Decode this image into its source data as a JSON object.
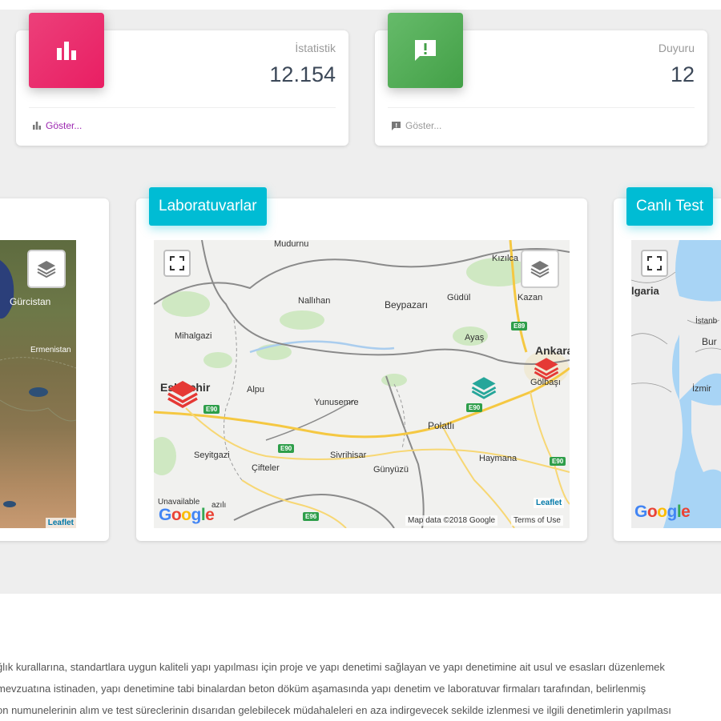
{
  "stats": [
    {
      "title": "İstatistik",
      "value": "12.154",
      "footer": "Göster...",
      "icon": "bar-chart-icon",
      "color": "#e91e63",
      "footer_color": "#9c27b0"
    },
    {
      "title": "Duyuru",
      "value": "12",
      "footer": "Göster...",
      "icon": "announcement-icon",
      "color": "#4caf50",
      "footer_color": "#999999"
    }
  ],
  "maps": [
    {
      "title": "",
      "labels": [
        "Gürcistan",
        "Ermenistan"
      ],
      "attribution": "Leaflet"
    },
    {
      "title": "Laboratuvarlar",
      "labels": [
        "Mudurnu",
        "Kızılca",
        "Nallıhan",
        "Beypazarı",
        "Güdül",
        "Kazan",
        "Mihalgazi",
        "Ayaş",
        "Ankara",
        "Eskişehir",
        "Alpu",
        "Yunusemre",
        "Gölbaşı",
        "Polatlı",
        "Seyitgazi",
        "Sivrihisar",
        "Haymana",
        "Çifteler",
        "Günyüzü",
        "Unavailable",
        "azılı"
      ],
      "road_shields": [
        "E89",
        "E90",
        "E90",
        "E90",
        "E90",
        "E96"
      ],
      "attribution": "Leaflet",
      "map_data": "Map data ©2018 Google",
      "terms": "Terms of Use"
    },
    {
      "title": "Canlı Test",
      "labels": [
        "lgaria",
        "İstanb",
        "Bur",
        "İzmir"
      ],
      "attribution": ""
    }
  ],
  "google_logo": "Google",
  "description": [
    "ğlık kurallarına, standartlara uygun kaliteli yapı yapılması için proje ve yapı denetimi sağlayan ve yapı denetimine ait usul ve esasları düzenlemek",
    "mevzuatına istinaden, yapı denetimine tabi binalardan beton döküm aşamasında yapı denetim ve laboratuvar firmaları tarafından, belirlenmiş",
    "on numunelerinin alım ve test süreclerinin dısarıdan gelebilecek müdahaleleri en aza indirgevecek sekilde izlenmesi ve ilgili denetimlerin yapılması"
  ],
  "colors": {
    "accent": "#00bcd4",
    "marker_red": "#e53935",
    "marker_teal": "#26a69a"
  }
}
